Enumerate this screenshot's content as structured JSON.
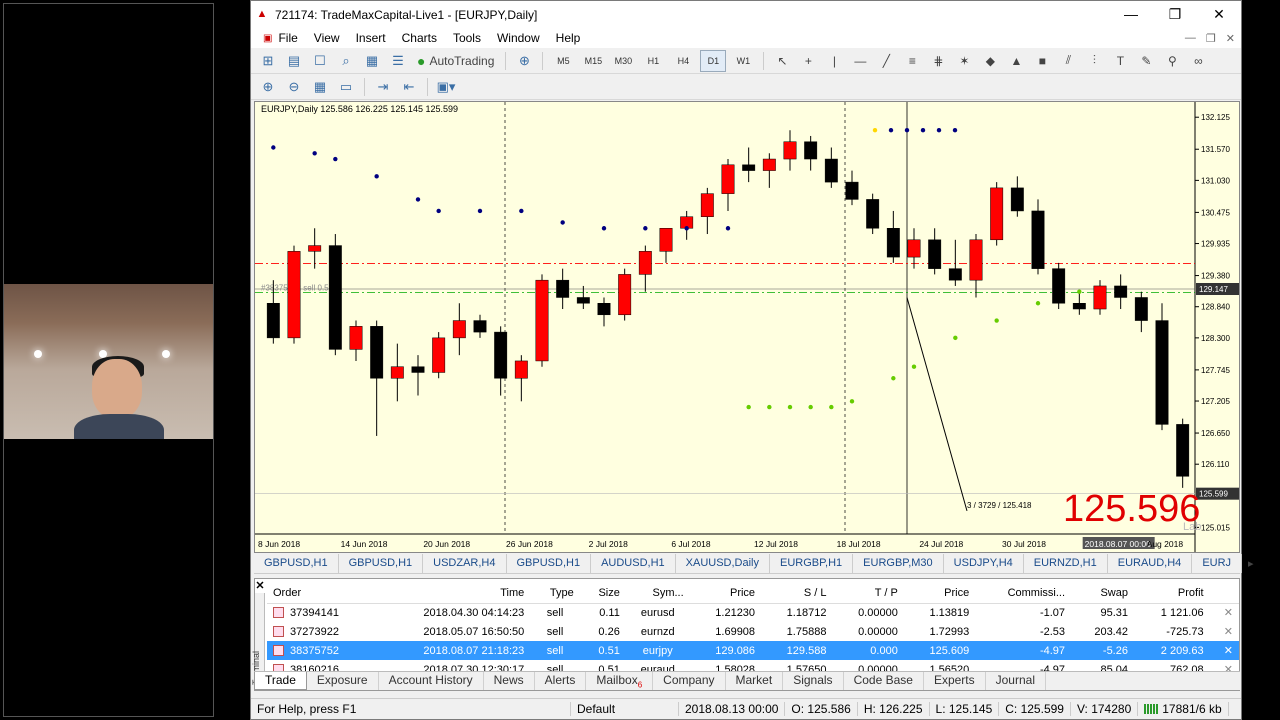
{
  "window": {
    "title": "721174: TradeMaxCapital-Live1 - [EURJPY,Daily]",
    "controls": [
      "—",
      "❐",
      "✕"
    ]
  },
  "menu": [
    "File",
    "View",
    "Insert",
    "Charts",
    "Tools",
    "Window",
    "Help"
  ],
  "toolbar": {
    "autotrading": "AutoTrading",
    "timeframes": [
      "M5",
      "M15",
      "M30",
      "H1",
      "H4",
      "D1",
      "W1"
    ],
    "active_tf": "D1"
  },
  "chart": {
    "info": "EURJPY,Daily  125.586 126.225 125.145 125.599",
    "big_price": "125.596",
    "crosshair_label": "3 / 3729 / 125.418",
    "order_line_label": "#38375752 sell 0.51",
    "watermark": "Lab"
  },
  "chart_data": {
    "type": "candlestick",
    "ylim": [
      124.9,
      132.25
    ],
    "y_ticks": [
      "132.125",
      "131.570",
      "131.030",
      "130.475",
      "129.935",
      "129.380",
      "128.840",
      "128.300",
      "127.745",
      "127.205",
      "126.650",
      "126.110",
      "125.015"
    ],
    "price_labels": [
      "129.147",
      "125.599"
    ],
    "x_labels": [
      "8 Jun 2018",
      "14 Jun 2018",
      "20 Jun 2018",
      "26 Jun 2018",
      "2 Jul 2018",
      "6 Jul 2018",
      "12 Jul 2018",
      "18 Jul 2018",
      "24 Jul 2018",
      "30 Jul 2018",
      "2018.08.07 00:00",
      "Aug 2018"
    ],
    "candles": [
      [
        128.9,
        129.3,
        128.2,
        128.3
      ],
      [
        128.3,
        129.9,
        128.2,
        129.8
      ],
      [
        129.8,
        130.2,
        129.5,
        129.9
      ],
      [
        129.9,
        130.1,
        128.0,
        128.1
      ],
      [
        128.1,
        128.6,
        127.9,
        128.5
      ],
      [
        128.5,
        128.6,
        126.6,
        127.6
      ],
      [
        127.6,
        128.2,
        127.2,
        127.8
      ],
      [
        127.8,
        128.0,
        127.3,
        127.7
      ],
      [
        127.7,
        128.4,
        127.6,
        128.3
      ],
      [
        128.3,
        128.9,
        128.0,
        128.6
      ],
      [
        128.6,
        128.7,
        128.3,
        128.4
      ],
      [
        128.4,
        128.5,
        127.3,
        127.6
      ],
      [
        127.6,
        128.0,
        127.2,
        127.9
      ],
      [
        127.9,
        129.4,
        127.8,
        129.3
      ],
      [
        129.3,
        129.5,
        128.8,
        129.0
      ],
      [
        129.0,
        129.2,
        128.8,
        128.9
      ],
      [
        128.9,
        129.0,
        128.5,
        128.7
      ],
      [
        128.7,
        129.5,
        128.6,
        129.4
      ],
      [
        129.4,
        129.9,
        129.1,
        129.8
      ],
      [
        129.8,
        130.2,
        129.6,
        130.2
      ],
      [
        130.2,
        130.5,
        130.0,
        130.4
      ],
      [
        130.4,
        130.9,
        130.1,
        130.8
      ],
      [
        130.8,
        131.4,
        130.5,
        131.3
      ],
      [
        131.3,
        131.6,
        131.0,
        131.2
      ],
      [
        131.2,
        131.5,
        130.9,
        131.4
      ],
      [
        131.4,
        131.9,
        131.2,
        131.7
      ],
      [
        131.7,
        131.8,
        131.2,
        131.4
      ],
      [
        131.4,
        131.6,
        130.9,
        131.0
      ],
      [
        131.0,
        131.2,
        130.6,
        130.7
      ],
      [
        130.7,
        130.8,
        130.1,
        130.2
      ],
      [
        130.2,
        130.5,
        129.6,
        129.7
      ],
      [
        129.7,
        130.2,
        129.5,
        130.0
      ],
      [
        130.0,
        130.2,
        129.4,
        129.5
      ],
      [
        129.5,
        130.0,
        129.2,
        129.3
      ],
      [
        129.3,
        130.1,
        129.0,
        130.0
      ],
      [
        130.0,
        131.0,
        129.9,
        130.9
      ],
      [
        130.9,
        131.1,
        130.4,
        130.5
      ],
      [
        130.5,
        130.7,
        129.4,
        129.5
      ],
      [
        129.5,
        129.6,
        128.8,
        128.9
      ],
      [
        128.9,
        129.1,
        128.7,
        128.8
      ],
      [
        128.8,
        129.3,
        128.7,
        129.2
      ],
      [
        129.2,
        129.4,
        128.8,
        129.0
      ],
      [
        129.0,
        129.1,
        128.4,
        128.6
      ],
      [
        128.6,
        128.9,
        126.7,
        126.8
      ],
      [
        126.8,
        126.9,
        125.7,
        125.9
      ]
    ],
    "overlay_series": [
      "parabolic-sar"
    ]
  },
  "symbol_tabs": [
    "GBPUSD,H1",
    "GBPUSD,H1",
    "USDZAR,H4",
    "GBPUSD,H1",
    "AUDUSD,H1",
    "XAUUSD,Daily",
    "EURGBP,H1",
    "EURGBP,M30",
    "USDJPY,H4",
    "EURNZD,H1",
    "EURAUD,H4",
    "EURJ"
  ],
  "terminal": {
    "side_label": "Terminal",
    "headers": [
      "Order",
      "Time",
      "Type",
      "Size",
      "Sym...",
      "Price",
      "S / L",
      "T / P",
      "Price",
      "Commissi...",
      "Swap",
      "Profit"
    ],
    "rows": [
      {
        "order": "37394141",
        "time": "2018.04.30 04:14:23",
        "type": "sell",
        "size": "0.11",
        "sym": "eurusd",
        "price": "1.21230",
        "sl": "1.18712",
        "tp": "0.00000",
        "cur": "1.13819",
        "comm": "-1.07",
        "swap": "95.31",
        "profit": "1 121.06",
        "selected": false
      },
      {
        "order": "37273922",
        "time": "2018.05.07 16:50:50",
        "type": "sell",
        "size": "0.26",
        "sym": "eurnzd",
        "price": "1.69908",
        "sl": "1.75888",
        "tp": "0.00000",
        "cur": "1.72993",
        "comm": "-2.53",
        "swap": "203.42",
        "profit": "-725.73",
        "selected": false
      },
      {
        "order": "38375752",
        "time": "2018.08.07 21:18:23",
        "type": "sell",
        "size": "0.51",
        "sym": "eurjpy",
        "price": "129.086",
        "sl": "129.588",
        "tp": "0.000",
        "cur": "125.609",
        "comm": "-4.97",
        "swap": "-5.26",
        "profit": "2 209.63",
        "selected": true
      },
      {
        "order": "38160216",
        "time": "2018.07.30 12:30:17",
        "type": "sell",
        "size": "0.51",
        "sym": "euraud",
        "price": "1.58028",
        "sl": "1.57650",
        "tp": "0.00000",
        "cur": "1.56520",
        "comm": "-4.97",
        "swap": "85.04",
        "profit": "762.08",
        "selected": false
      }
    ],
    "tabs": [
      "Trade",
      "Exposure",
      "Account History",
      "News",
      "Alerts",
      "Mailbox",
      "Company",
      "Market",
      "Signals",
      "Code Base",
      "Experts",
      "Journal"
    ],
    "mailbox_badge": "6",
    "active_tab": "Trade"
  },
  "status": {
    "help": "For Help, press F1",
    "profile": "Default",
    "datetime": "2018.08.13 00:00",
    "o": "O: 125.586",
    "h": "H: 126.225",
    "l": "L: 125.145",
    "c": "C: 125.599",
    "v": "V: 174280",
    "traffic": "17881/6 kb"
  },
  "colors": {
    "bull": "#ff0000",
    "bear": "#000000",
    "chart_bg": "#ffffe0",
    "sar_up": "#ffd700",
    "sar_down": "#66cc00",
    "selected_row": "#3399ff"
  }
}
